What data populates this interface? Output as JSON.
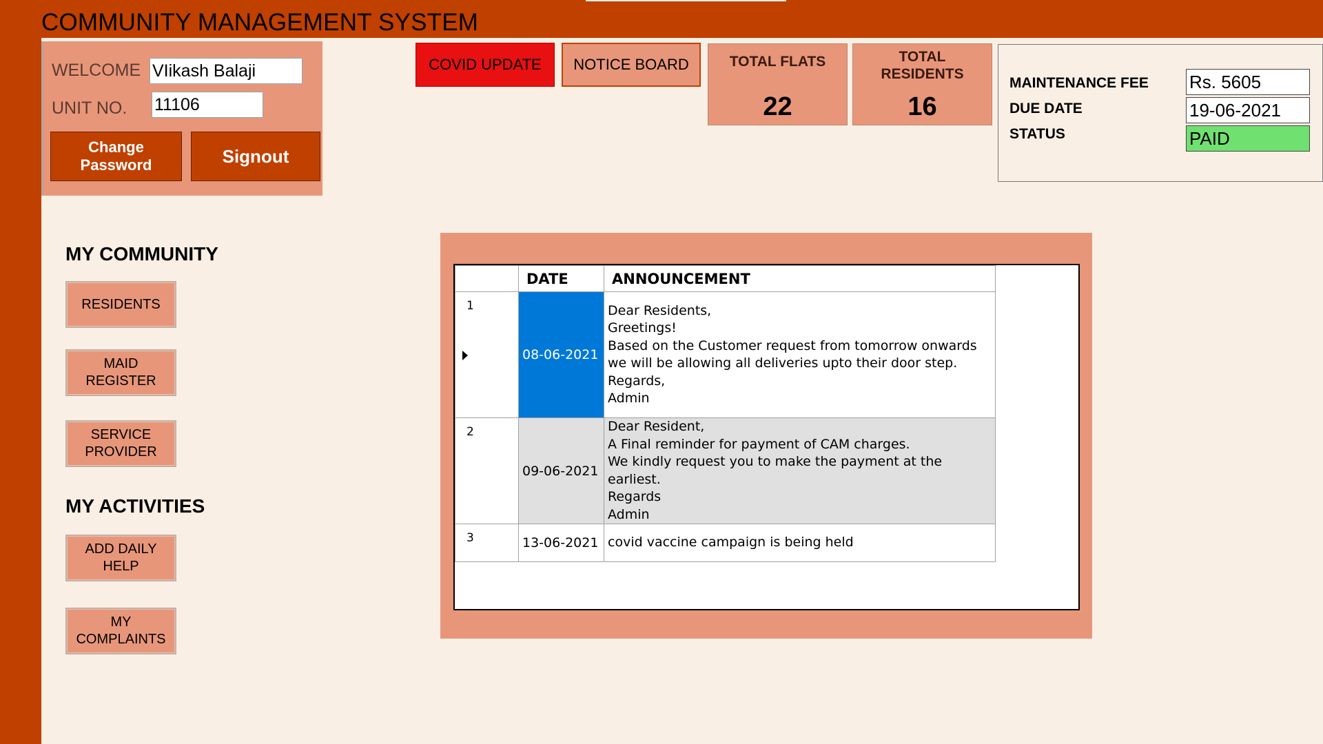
{
  "app": {
    "title": "COMMUNITY MANAGEMENT SYSTEM"
  },
  "user": {
    "welcome_label": "WELCOME",
    "name": "VIikash Balaji",
    "unit_label": "UNIT NO.",
    "unit": "11106",
    "change_password": "Change Password",
    "signout": "Signout"
  },
  "top_buttons": {
    "covid": "COVID UPDATE",
    "notice": "NOTICE BOARD"
  },
  "stats": {
    "total_flats_label": "TOTAL FLATS",
    "total_flats": "22",
    "total_residents_label": "TOTAL RESIDENTS",
    "total_residents": "16"
  },
  "fee": {
    "maintenance_label": "MAINTENANCE FEE",
    "maintenance_value": "Rs. 5605",
    "due_label": "DUE DATE",
    "due_value": "19-06-2021",
    "status_label": "STATUS",
    "status_value": "PAID"
  },
  "sidebar": {
    "community_title": "MY COMMUNITY",
    "community_items": [
      "RESIDENTS",
      "MAID REGISTER",
      "SERVICE PROVIDER"
    ],
    "activities_title": "MY ACTIVITIES",
    "activities_items": [
      "ADD DAILY HELP",
      "MY COMPLAINTS"
    ]
  },
  "announcements": {
    "columns": [
      "DATE",
      "ANNOUNCEMENT"
    ],
    "rows": [
      {
        "num": "1",
        "date": "08-06-2021",
        "text": "Dear Residents,\nGreetings!\nBased on the Customer request from tomorrow onwards we will be allowing all deliveries upto their door step.\nRegards,\nAdmin"
      },
      {
        "num": "2",
        "date": "09-06-2021",
        "text": "Dear Resident,\nA Final reminder for payment of CAM charges.\nWe kindly request you to make the payment at the earliest.\nRegards\nAdmin"
      },
      {
        "num": "3",
        "date": "13-06-2021",
        "text": "covid vaccine campaign is being held"
      }
    ]
  },
  "colors": {
    "brand": "#C04000",
    "panel": "#E8967A",
    "background": "#FAEFE5",
    "covid_button": "#E81010",
    "selected": "#0078D7",
    "paid": "#70E070"
  }
}
